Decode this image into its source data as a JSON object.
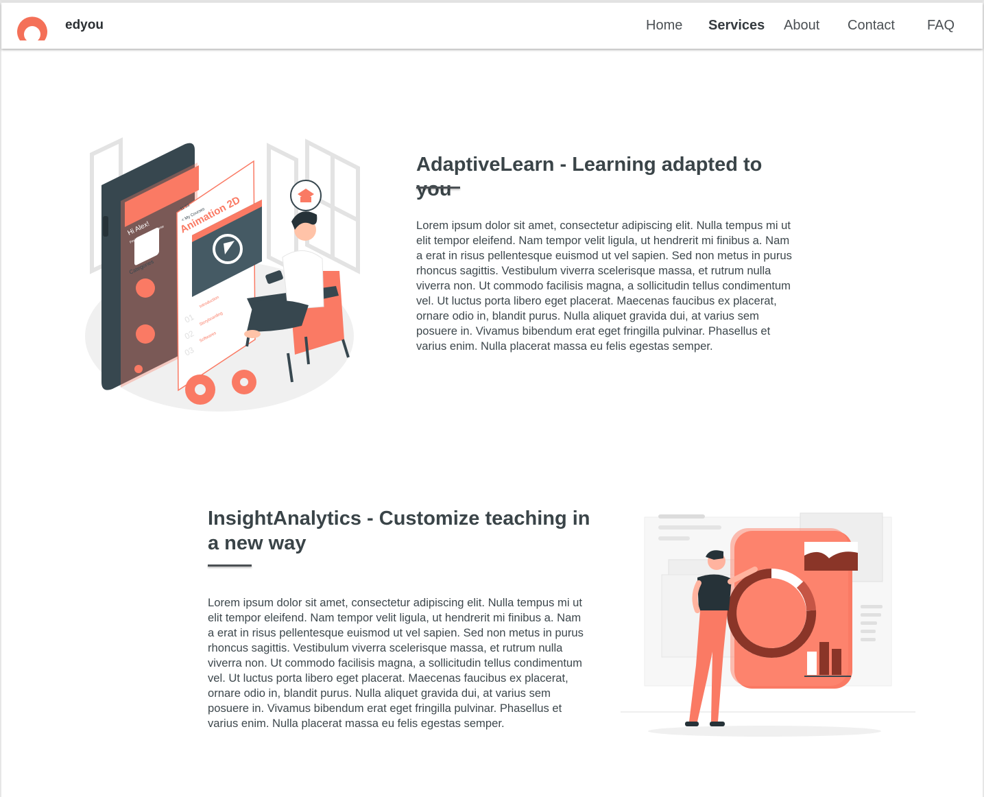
{
  "brand": {
    "name": "edyou",
    "logo_color": "#f47058"
  },
  "nav": {
    "items": [
      {
        "label": "Home"
      },
      {
        "label": "Services",
        "active": true
      },
      {
        "label": "About"
      },
      {
        "label": "Contact"
      },
      {
        "label": "FAQ"
      }
    ]
  },
  "colors": {
    "accent": "#fa7a64",
    "dark": "#37474f"
  },
  "sections": [
    {
      "title": "AdaptiveLearn - Learning adapted to you",
      "body": "Lorem ipsum dolor sit amet, consectetur adipiscing elit. Nulla tempus mi ut elit tempor eleifend. Nam tempor velit ligula, ut hendrerit mi finibus a. Nam a erat in risus pellentesque euismod ut vel sapien. Sed non metus in purus rhoncus sagittis. Vestibulum viverra scelerisque massa, et rutrum nulla viverra non. Ut commodo facilisis magna, a sollicitudin tellus condimentum vel. Ut luctus porta libero eget placerat. Maecenas faucibus ex placerat, ornare odio in, blandit purus. Nulla aliquet gravida dui, at varius sem posuere in. Vivamus bibendum erat eget fringilla pulvinar. Phasellus et varius enim. Nulla placerat massa eu felis egestas semper.",
      "illustration": {
        "phone_greeting": "Hi Alex!",
        "phone_subtitle": "Find your favorite course",
        "phone_categories": "Categories",
        "course_title": "Animation 2D",
        "course_breadcrumb": "< My Courses",
        "course_time": "11:53",
        "lessons": [
          {
            "num": "01",
            "name": "Introduction"
          },
          {
            "num": "02",
            "name": "Storyboarding"
          },
          {
            "num": "03",
            "name": "Softwares"
          }
        ]
      }
    },
    {
      "title": "InsightAnalytics - Customize teaching in a new way",
      "body": "Lorem ipsum dolor sit amet, consectetur adipiscing elit. Nulla tempus mi ut elit tempor eleifend. Nam tempor velit ligula, ut hendrerit mi finibus a. Nam a erat in risus pellentesque euismod ut vel sapien. Sed non metus in purus rhoncus sagittis. Vestibulum viverra scelerisque massa, et rutrum nulla viverra non. Ut commodo facilisis magna, a sollicitudin tellus condimentum vel. Ut luctus porta libero eget placerat. Maecenas faucibus ex placerat, ornare odio in, blandit purus. Nulla aliquet gravida dui, at varius sem posuere in. Vivamus bibendum erat eget fringilla pulvinar. Phasellus et varius enim. Nulla placerat massa eu felis egestas semper."
    }
  ]
}
